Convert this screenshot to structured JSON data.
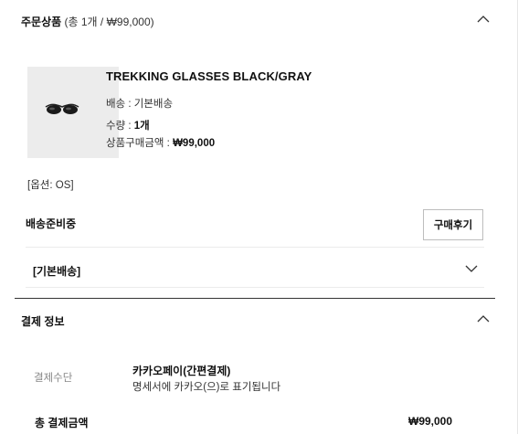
{
  "order_section": {
    "title": "주문상품",
    "subtitle": "(총 1개 / ₩99,000)",
    "collapse_icon": "chevron-up-icon"
  },
  "product": {
    "image_icon": "sunglasses-icon",
    "name": "TREKKING GLASSES BLACK/GRAY",
    "shipping_label": "배송 : ",
    "shipping_value": "기본배송",
    "quantity_label": "수량 : ",
    "quantity_value": "1개",
    "price_label": "상품구매금액 : ",
    "price_value": "₩99,000",
    "option": "[옵션: OS]"
  },
  "status": {
    "text": "배송준비중",
    "review_button": "구매후기"
  },
  "shipping_group": {
    "label": "[기본배송]",
    "expand_icon": "chevron-down-icon"
  },
  "payment_section": {
    "title": "결제 정보",
    "collapse_icon": "chevron-up-icon",
    "method_label": "결제수단",
    "method_value": "카카오페이(간편결제)",
    "method_note": "명세서에 카카오(으)로 표기됩니다",
    "total_label": "총 결제금액",
    "total_value": "₩99,000"
  }
}
